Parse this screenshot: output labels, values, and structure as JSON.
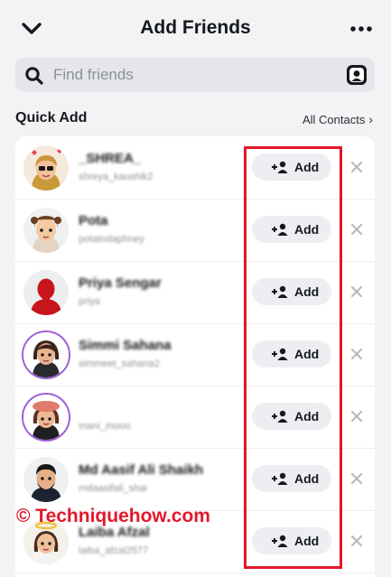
{
  "header": {
    "title": "Add Friends",
    "back_icon": "chevron-down-icon",
    "more_icon": "more-icon"
  },
  "search": {
    "placeholder": "Find friends",
    "value": ""
  },
  "quick_add": {
    "title": "Quick Add",
    "all_contacts_label": "All Contacts",
    "add_label": "Add",
    "rows": [
      {
        "name": "_SHREA_",
        "sub": "shreya_kaushik2"
      },
      {
        "name": "Pota",
        "sub": "potatodaphney"
      },
      {
        "name": "Priya Sengar",
        "sub": "priya"
      },
      {
        "name": "Simmi Sahana",
        "sub": "simmeet_sahana2"
      },
      {
        "name": "",
        "sub": "mani_mooo"
      },
      {
        "name": "Md Aasif Ali Shaikh",
        "sub": "mdaasifali_shai"
      },
      {
        "name": "Laiba Afzal",
        "sub": "laiba_afzal2577"
      }
    ]
  },
  "watermark": "© Techniquehow.com",
  "colors": {
    "background": "#f2f3f5",
    "card": "#ffffff",
    "button": "#edeef1",
    "highlight": "#e3172a",
    "ring": "#9b5cd6"
  }
}
